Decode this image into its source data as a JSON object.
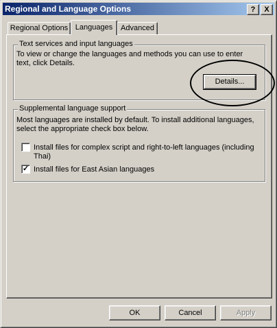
{
  "window": {
    "title": "Regional and Language Options",
    "help_label": "?",
    "close_label": "X"
  },
  "tabs": [
    {
      "label": "Regional Options",
      "active": false
    },
    {
      "label": "Languages",
      "active": true
    },
    {
      "label": "Advanced",
      "active": false
    }
  ],
  "text_services": {
    "legend": "Text services and input languages",
    "description_line1": "To view or change the languages and methods you can use to enter",
    "description_line2": "text, click Details.",
    "details_button": "Details..."
  },
  "supplemental": {
    "legend": "Supplemental language support",
    "description_line1": "Most languages are installed by default. To install additional languages,",
    "description_line2": "select the appropriate check box below.",
    "checkbox_complex_line1": "Install files for complex script and right-to-left languages (including",
    "checkbox_complex_line2": "Thai)",
    "checkbox_complex_checked": false,
    "checkbox_east_asian": "Install files for East Asian languages",
    "checkbox_east_asian_checked": true,
    "check_mark": "✓"
  },
  "footer": {
    "ok": "OK",
    "cancel": "Cancel",
    "apply": "Apply"
  },
  "colors": {
    "titlebar_start": "#0a246a",
    "titlebar_end": "#a6caf0",
    "face": "#d4d0c8"
  }
}
